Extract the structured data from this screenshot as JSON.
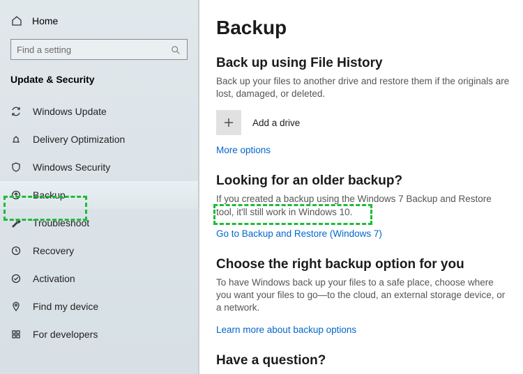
{
  "sidebar": {
    "home_label": "Home",
    "search_placeholder": "Find a setting",
    "category": "Update & Security",
    "items": [
      {
        "label": "Windows Update"
      },
      {
        "label": "Delivery Optimization"
      },
      {
        "label": "Windows Security"
      },
      {
        "label": "Backup"
      },
      {
        "label": "Troubleshoot"
      },
      {
        "label": "Recovery"
      },
      {
        "label": "Activation"
      },
      {
        "label": "Find my device"
      },
      {
        "label": "For developers"
      }
    ]
  },
  "page": {
    "title": "Backup",
    "sec1": {
      "heading": "Back up using File History",
      "desc": "Back up your files to another drive and restore them if the originals are lost, damaged, or deleted.",
      "add_drive": "Add a drive",
      "more_options": "More options"
    },
    "sec2": {
      "heading": "Looking for an older backup?",
      "desc": "If you created a backup using the Windows 7 Backup and Restore tool, it'll still work in Windows 10.",
      "link": "Go to Backup and Restore (Windows 7)"
    },
    "sec3": {
      "heading": "Choose the right backup option for you",
      "desc": "To have Windows back up your files to a safe place, choose where you want your files to go—to the cloud, an external storage device, or a network.",
      "link": "Learn more about backup options"
    },
    "sec4": {
      "heading": "Have a question?"
    }
  }
}
